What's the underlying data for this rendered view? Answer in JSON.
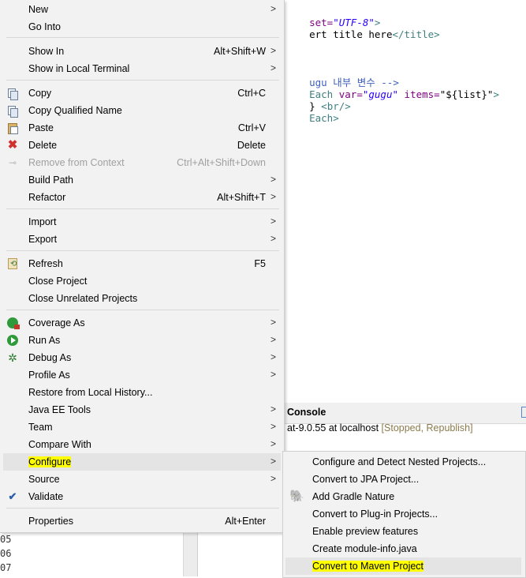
{
  "editor": {
    "line1": {
      "attr": "set=",
      "value": "\"UTF-8\"",
      "tail": ">"
    },
    "line2": {
      "text": "ert title here",
      "tag": "</title>"
    },
    "line3": {
      "comment": "ugu 내부 변수 -->"
    },
    "line4": {
      "tag": "Each",
      "attr1": " var=",
      "val1": "\"gugu\"",
      "attr2": " items=",
      "val2": "\"${list}\"",
      "tail": ">"
    },
    "line5": {
      "plain": "} ",
      "tag": "<br/>"
    },
    "line6": {
      "tag": "Each>"
    }
  },
  "console": {
    "title": "Console",
    "server": "at-9.0.55 at localhost",
    "status": "[Stopped, Republish]"
  },
  "line_numbers": [
    "05",
    "06",
    "07"
  ],
  "context_menu": {
    "items": [
      {
        "label": "New",
        "shortcut": "",
        "submenu": true,
        "icon": ""
      },
      {
        "label": "Go Into",
        "shortcut": "",
        "submenu": false,
        "icon": ""
      },
      {
        "label": "Show In",
        "shortcut": "Alt+Shift+W",
        "submenu": true,
        "icon": ""
      },
      {
        "label": "Show in Local Terminal",
        "shortcut": "",
        "submenu": true,
        "icon": ""
      },
      {
        "label": "Copy",
        "shortcut": "Ctrl+C",
        "submenu": false,
        "icon": "copy-icon"
      },
      {
        "label": "Copy Qualified Name",
        "shortcut": "",
        "submenu": false,
        "icon": "copy-qualified-icon"
      },
      {
        "label": "Paste",
        "shortcut": "Ctrl+V",
        "submenu": false,
        "icon": "paste-icon"
      },
      {
        "label": "Delete",
        "shortcut": "Delete",
        "submenu": false,
        "icon": "delete-icon"
      },
      {
        "label": "Remove from Context",
        "shortcut": "Ctrl+Alt+Shift+Down",
        "submenu": false,
        "icon": "remove-context-icon",
        "disabled": true
      },
      {
        "label": "Build Path",
        "shortcut": "",
        "submenu": true,
        "icon": ""
      },
      {
        "label": "Refactor",
        "shortcut": "Alt+Shift+T",
        "submenu": true,
        "icon": ""
      },
      {
        "label": "Import",
        "shortcut": "",
        "submenu": true,
        "icon": ""
      },
      {
        "label": "Export",
        "shortcut": "",
        "submenu": true,
        "icon": ""
      },
      {
        "label": "Refresh",
        "shortcut": "F5",
        "submenu": false,
        "icon": "refresh-icon"
      },
      {
        "label": "Close Project",
        "shortcut": "",
        "submenu": false,
        "icon": ""
      },
      {
        "label": "Close Unrelated Projects",
        "shortcut": "",
        "submenu": false,
        "icon": ""
      },
      {
        "label": "Coverage As",
        "shortcut": "",
        "submenu": true,
        "icon": "coverage-icon"
      },
      {
        "label": "Run As",
        "shortcut": "",
        "submenu": true,
        "icon": "run-icon"
      },
      {
        "label": "Debug As",
        "shortcut": "",
        "submenu": true,
        "icon": "debug-icon"
      },
      {
        "label": "Profile As",
        "shortcut": "",
        "submenu": true,
        "icon": ""
      },
      {
        "label": "Restore from Local History...",
        "shortcut": "",
        "submenu": false,
        "icon": ""
      },
      {
        "label": "Java EE Tools",
        "shortcut": "",
        "submenu": true,
        "icon": ""
      },
      {
        "label": "Team",
        "shortcut": "",
        "submenu": true,
        "icon": ""
      },
      {
        "label": "Compare With",
        "shortcut": "",
        "submenu": true,
        "icon": ""
      },
      {
        "label": "Configure",
        "shortcut": "",
        "submenu": true,
        "icon": "",
        "highlighted": true
      },
      {
        "label": "Source",
        "shortcut": "",
        "submenu": true,
        "icon": ""
      },
      {
        "label": "Validate",
        "shortcut": "",
        "submenu": false,
        "icon": "check-icon"
      },
      {
        "label": "Properties",
        "shortcut": "Alt+Enter",
        "submenu": false,
        "icon": ""
      }
    ]
  },
  "configure_submenu": {
    "items": [
      {
        "label": "Configure and Detect Nested Projects...",
        "icon": ""
      },
      {
        "label": "Convert to JPA Project...",
        "icon": ""
      },
      {
        "label": "Add Gradle Nature",
        "icon": "gradle-icon"
      },
      {
        "label": "Convert to Plug-in Projects...",
        "icon": ""
      },
      {
        "label": "Enable preview features",
        "icon": ""
      },
      {
        "label": "Create module-info.java",
        "icon": ""
      },
      {
        "label": "Convert to Maven Project",
        "icon": "",
        "highlighted": true
      }
    ]
  },
  "colors": {
    "highlight": "#ffff00",
    "menu_bg": "#f2f2f2"
  }
}
